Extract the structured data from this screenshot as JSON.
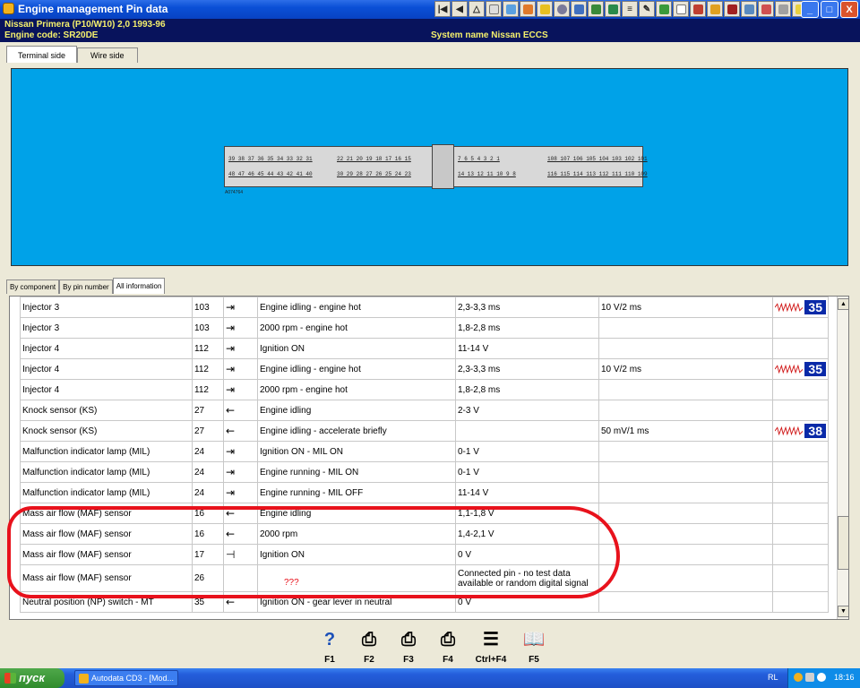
{
  "window": {
    "title": "Engine management Pin data",
    "buttons": {
      "minimize": "_",
      "maximize": "□",
      "close": "X"
    }
  },
  "info": {
    "car": "Nissan   Primera (P10/W10) 2,0  1993-96",
    "engine_code": "Engine code: SR20DE",
    "system": "System name Nissan ECCS"
  },
  "view_tabs": [
    {
      "label": "Terminal side"
    },
    {
      "label": "Wire side"
    }
  ],
  "connector": {
    "top_left": "39 38 37 36 35 34 33 32 31",
    "top_mid": "22 21 20 19 18 17 16 15",
    "top_right": "7  6  5  4  3  2  1",
    "top_far": "108 107 106 105 104 103 102 101",
    "bottom_left": "48 47 46 45 44 43 42 41 40",
    "bottom_mid": "30 29 28 27 26 25 24 23",
    "bottom_right": "14 13 12 11 10  9  8",
    "bottom_far": "116 115 114 113 112 111 110 109",
    "label": "A074764"
  },
  "info_tabs": [
    {
      "label": "By component"
    },
    {
      "label": "By pin number"
    },
    {
      "label": "All information"
    }
  ],
  "rows": [
    {
      "component": "Injector 3",
      "pin": "103",
      "dir": "⇥",
      "condition": "Engine idling - engine hot",
      "value": "2,3-3,3 ms",
      "scope": "10 V/2 ms",
      "ref": "35"
    },
    {
      "component": "Injector 3",
      "pin": "103",
      "dir": "⇥",
      "condition": "2000 rpm - engine hot",
      "value": "1,8-2,8 ms",
      "scope": "",
      "ref": ""
    },
    {
      "component": "Injector 4",
      "pin": "112",
      "dir": "⇥",
      "condition": "Ignition ON",
      "value": "11-14 V",
      "scope": "",
      "ref": ""
    },
    {
      "component": "Injector 4",
      "pin": "112",
      "dir": "⇥",
      "condition": "Engine idling - engine hot",
      "value": "2,3-3,3 ms",
      "scope": "10 V/2 ms",
      "ref": "35"
    },
    {
      "component": "Injector 4",
      "pin": "112",
      "dir": "⇥",
      "condition": "2000 rpm - engine hot",
      "value": "1,8-2,8 ms",
      "scope": "",
      "ref": ""
    },
    {
      "component": "Knock sensor (KS)",
      "pin": "27",
      "dir": "←",
      "condition": "Engine idling",
      "value": "2-3 V",
      "scope": "",
      "ref": ""
    },
    {
      "component": "Knock sensor (KS)",
      "pin": "27",
      "dir": "←",
      "condition": "Engine idling - accelerate briefly",
      "value": "",
      "scope": "50 mV/1 ms",
      "ref": "38"
    },
    {
      "component": "Malfunction indicator lamp (MIL)",
      "pin": "24",
      "dir": "⇥",
      "condition": "Ignition ON - MIL ON",
      "value": "0-1 V",
      "scope": "",
      "ref": ""
    },
    {
      "component": "Malfunction indicator lamp (MIL)",
      "pin": "24",
      "dir": "⇥",
      "condition": "Engine running - MIL ON",
      "value": "0-1 V",
      "scope": "",
      "ref": ""
    },
    {
      "component": "Malfunction indicator lamp (MIL)",
      "pin": "24",
      "dir": "⇥",
      "condition": "Engine running - MIL OFF",
      "value": "11-14 V",
      "scope": "",
      "ref": ""
    },
    {
      "component": "Mass air flow (MAF) sensor",
      "pin": "16",
      "dir": "←",
      "condition": "Engine idling",
      "value": "1,1-1,8 V",
      "scope": "",
      "ref": ""
    },
    {
      "component": "Mass air flow (MAF) sensor",
      "pin": "16",
      "dir": "←",
      "condition": "2000 rpm",
      "value": "1,4-2,1 V",
      "scope": "",
      "ref": ""
    },
    {
      "component": "Mass air flow (MAF) sensor",
      "pin": "17",
      "dir": "⊣",
      "condition": "Ignition ON",
      "value": "0 V",
      "scope": "",
      "ref": ""
    },
    {
      "component": "Mass air flow (MAF) sensor",
      "pin": "26",
      "dir": "",
      "condition": "",
      "value": "Connected pin - no test data available or random digital signal",
      "scope": "",
      "ref": ""
    },
    {
      "component": "Neutral position (NP) switch - MT",
      "pin": "35",
      "dir": "←",
      "condition": "Ignition ON - gear lever in neutral",
      "value": "0 V",
      "scope": "",
      "ref": ""
    }
  ],
  "annotation": {
    "text": "???",
    "color": "#e8121c"
  },
  "fkeys": [
    {
      "label": "F1",
      "icon": "help-icon"
    },
    {
      "label": "F2",
      "icon": "print-icon"
    },
    {
      "label": "F3",
      "icon": "print-preview-icon"
    },
    {
      "label": "F4",
      "icon": "print-page-icon"
    },
    {
      "label": "Ctrl+F4",
      "icon": "print-list-icon"
    },
    {
      "label": "F5",
      "icon": "book-icon"
    }
  ],
  "taskbar": {
    "start": "пуск",
    "task": "Autodata CD3 - [Mod...",
    "lang": "RL",
    "time": "18:16"
  },
  "colors": {
    "diagram_bg": "#00a2e8",
    "info_bar": "#08135c",
    "info_text": "#f5f06c",
    "ref_badge": "#0a2aa8",
    "annotation": "#e8121c"
  }
}
